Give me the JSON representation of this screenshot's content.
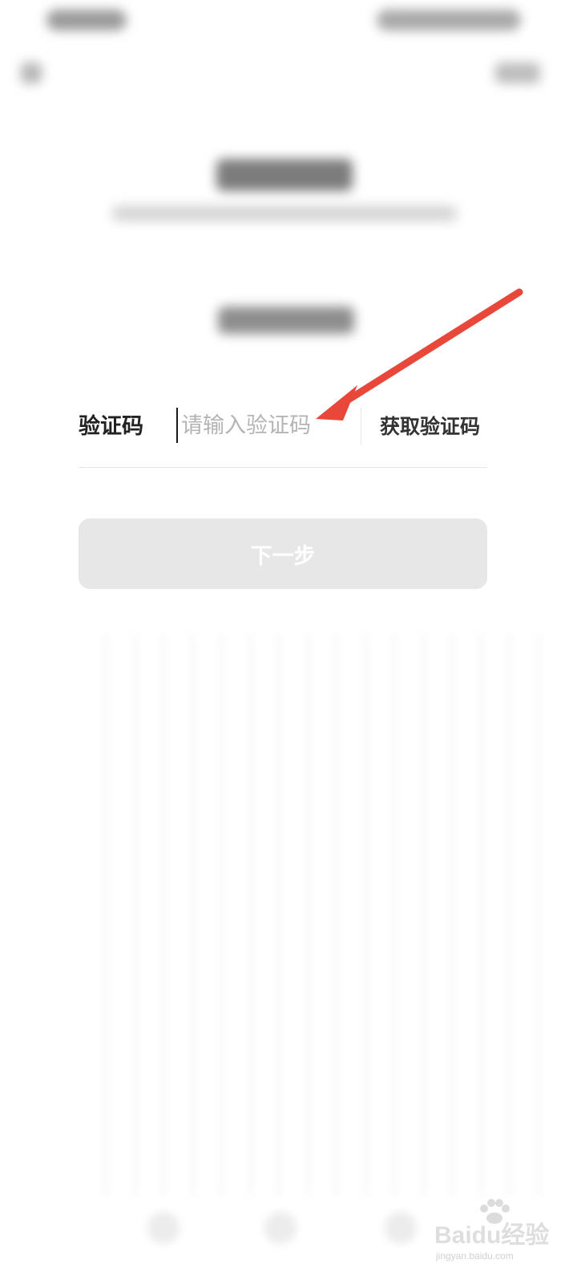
{
  "verification": {
    "label": "验证码",
    "input_placeholder": "请输入验证码",
    "input_value": "",
    "get_code_label": "获取验证码"
  },
  "actions": {
    "next_label": "下一步"
  },
  "annotation": {
    "arrow_color": "#e8473a"
  },
  "watermark": {
    "brand": "Baidu经验",
    "site": "jingyan.baidu.com"
  },
  "colors": {
    "next_button_bg": "#e7e7e7",
    "placeholder": "#b4b4b4"
  }
}
